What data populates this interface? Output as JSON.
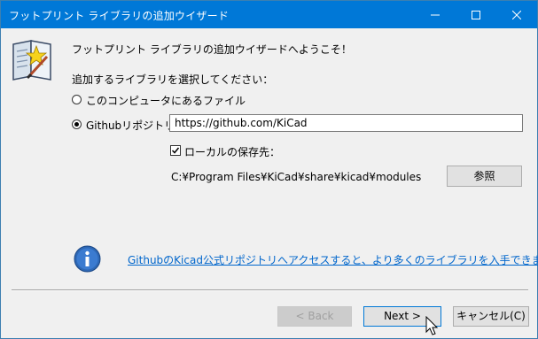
{
  "window": {
    "title": "フットプリント ライブラリの追加ウイザード",
    "controls": [
      "minimize-icon",
      "maximize-icon",
      "close-icon"
    ]
  },
  "wizard": {
    "welcome": "フットプリント ライブラリの追加ウイザードへようこそ！",
    "select_prompt": "追加するライブラリを選択してください：",
    "source_options": [
      {
        "label": "このコンピュータにあるファイル",
        "selected": false
      },
      {
        "label": "Githubリポジトリ",
        "selected": true
      }
    ],
    "github_url": "https://github.com/KiCad",
    "local_save": {
      "label": "ローカルの保存先：",
      "checked": true
    },
    "local_path": "C:¥Program Files¥KiCad¥share¥kicad¥modules",
    "browse_label": "参照",
    "info_link": "GithubのKicad公式リポジトリへアクセスすると、より多くのライブラリを入手できます"
  },
  "footer": {
    "back_label": "< Back",
    "next_label": "Next >",
    "cancel_label": "キャンセル(C)"
  },
  "colors": {
    "titlebar": "#0078d7",
    "link": "#0066cc",
    "focus_border": "#0078d7"
  }
}
